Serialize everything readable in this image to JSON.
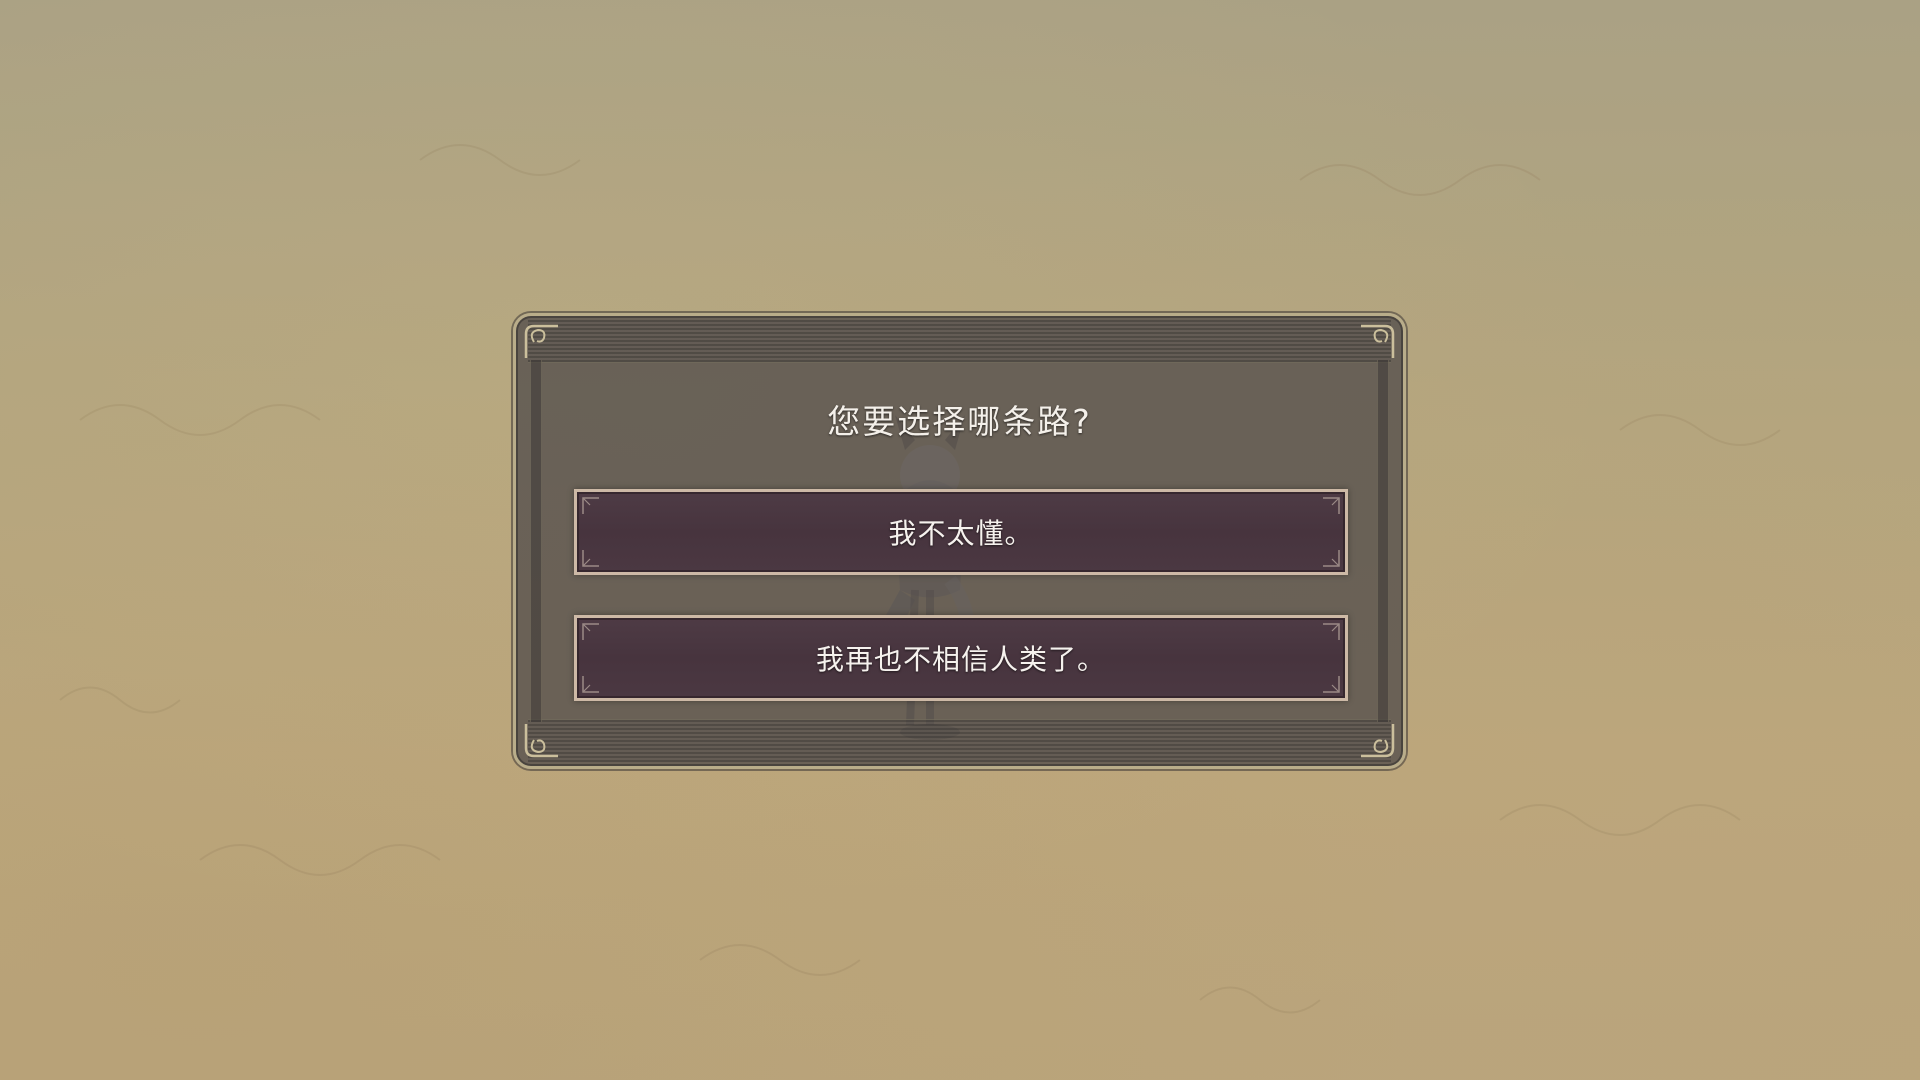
{
  "dialog": {
    "title": "您要选择哪条路?"
  },
  "choices": [
    {
      "label": "我不太懂。"
    },
    {
      "label": "我再也不相信人类了。"
    }
  ],
  "colors": {
    "background": "#bcae84",
    "dialog_bg": "#58524e",
    "dialog_border": "#b9ad8a",
    "choice_bg": "#4b3842",
    "choice_border": "#cdb9a6",
    "text": "#f4f0ea"
  },
  "icons": {
    "dialog_corner": "scroll-ornament-icon",
    "choice_corner": "corner-tick-icon"
  }
}
